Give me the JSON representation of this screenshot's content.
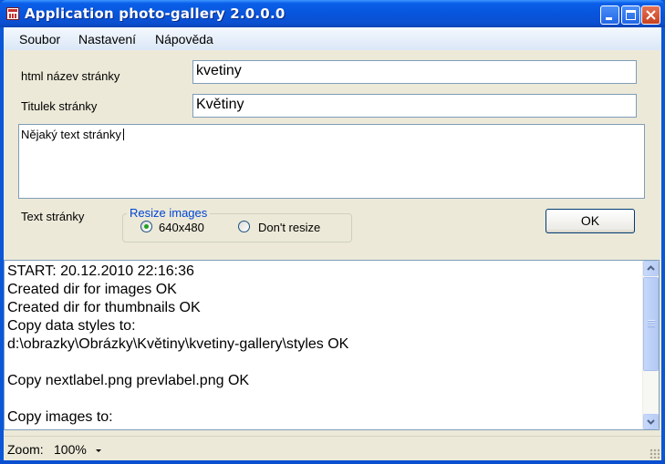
{
  "window": {
    "title": "Application photo-gallery 2.0.0.0"
  },
  "menu": {
    "items": [
      {
        "label": "Soubor"
      },
      {
        "label": "Nastavení"
      },
      {
        "label": "Nápověda"
      }
    ]
  },
  "form": {
    "html_name_label": "html název stránky",
    "html_name_value": "kvetiny",
    "page_title_label": "Titulek stránky",
    "page_title_value": "Květiny",
    "page_text_value": "Nějaký text stránky",
    "page_text_label": "Text stránky",
    "resize_group_label": "Resize images",
    "resize_options": [
      {
        "label": "640x480",
        "checked": true
      },
      {
        "label": "Don't resize",
        "checked": false
      }
    ],
    "ok_label": "OK"
  },
  "log": {
    "lines": [
      "START: 20.12.2010 22:16:36",
      "Created dir for images OK",
      "Created dir for thumbnails OK",
      "Copy data styles to:",
      "d:\\obrazky\\Obrázky\\Květiny\\kvetiny-gallery\\styles OK",
      "",
      "Copy nextlabel.png prevlabel.png OK",
      "",
      "Copy images to:"
    ]
  },
  "status": {
    "zoom_label": "Zoom:",
    "zoom_value": "100%"
  },
  "colors": {
    "title_bar": "#0855dd",
    "group_legend": "#0046d5",
    "radio_checked": "#21a121"
  }
}
